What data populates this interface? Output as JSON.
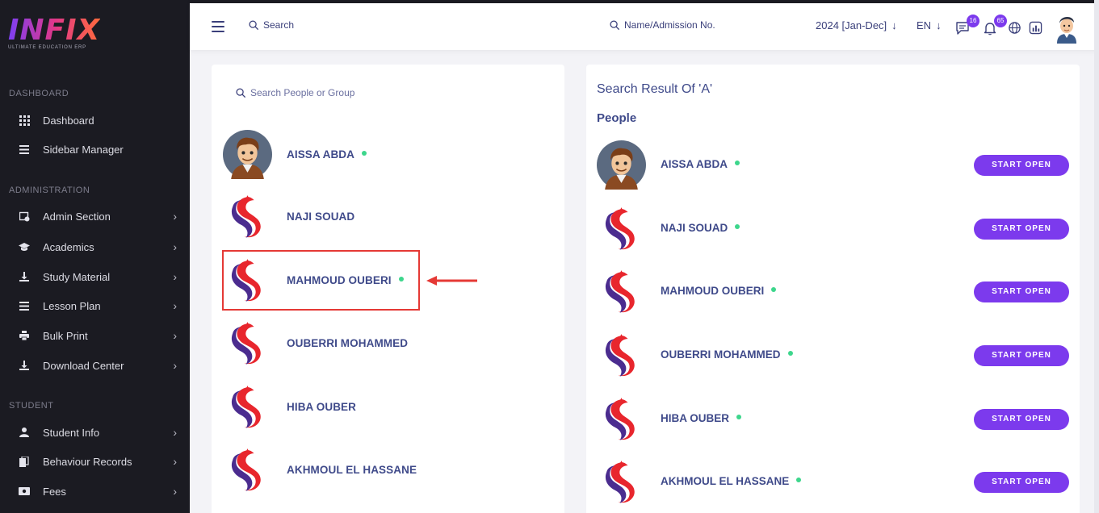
{
  "brand": {
    "name": "INFIX",
    "tagline": "ULTIMATE EDUCATION ERP"
  },
  "sidebar": {
    "sections": [
      {
        "title": "DASHBOARD"
      },
      {
        "title": "ADMINISTRATION"
      },
      {
        "title": "STUDENT"
      }
    ],
    "items": [
      {
        "label": "Dashboard",
        "icon": "grid-icon"
      },
      {
        "label": "Sidebar Manager",
        "icon": "list-icon"
      },
      {
        "label": "Admin Section",
        "icon": "admin-icon"
      },
      {
        "label": "Academics",
        "icon": "graduation-cap-icon"
      },
      {
        "label": "Study Material",
        "icon": "download-icon"
      },
      {
        "label": "Lesson Plan",
        "icon": "list-icon"
      },
      {
        "label": "Bulk Print",
        "icon": "printer-icon"
      },
      {
        "label": "Download Center",
        "icon": "download-icon"
      },
      {
        "label": "Student Info",
        "icon": "user-icon"
      },
      {
        "label": "Behaviour Records",
        "icon": "file-icon"
      },
      {
        "label": "Fees",
        "icon": "money-icon"
      }
    ]
  },
  "header": {
    "search_label": "Search",
    "admission_search_label": "Name/Admission No.",
    "year": "2024 [Jan-Dec]",
    "language": "EN",
    "messages_count": "16",
    "notifications_count": "65"
  },
  "left_panel": {
    "search_placeholder": "Search People or Group",
    "people": [
      {
        "name": "AISSA ABDA",
        "online": true,
        "avatar": "cartoon"
      },
      {
        "name": "NAJI SOUAD",
        "online": false,
        "avatar": "logo"
      },
      {
        "name": "MAHMOUD OUBERI",
        "online": true,
        "avatar": "logo"
      },
      {
        "name": "OUBERRI MOHAMMED",
        "online": false,
        "avatar": "logo"
      },
      {
        "name": "HIBA OUBER",
        "online": false,
        "avatar": "logo"
      },
      {
        "name": "AKHMOUL EL HASSANE",
        "online": false,
        "avatar": "logo"
      }
    ]
  },
  "right_panel": {
    "title": "Search Result Of 'A'",
    "people_heading": "People",
    "button_label": "START OPEN",
    "results": [
      {
        "name": "AISSA ABDA",
        "avatar": "cartoon"
      },
      {
        "name": "NAJI SOUAD",
        "avatar": "logo"
      },
      {
        "name": "MAHMOUD OUBERI",
        "avatar": "logo"
      },
      {
        "name": "OUBERRI MOHAMMED",
        "avatar": "logo"
      },
      {
        "name": "HIBA OUBER",
        "avatar": "logo"
      },
      {
        "name": "AKHMOUL EL HASSANE",
        "avatar": "logo"
      }
    ]
  },
  "colors": {
    "accent": "#7c3aed",
    "online": "#3dd68c",
    "text": "#3f4a8a",
    "sidebar_bg": "#1b1b22",
    "highlight": "#e53935"
  }
}
